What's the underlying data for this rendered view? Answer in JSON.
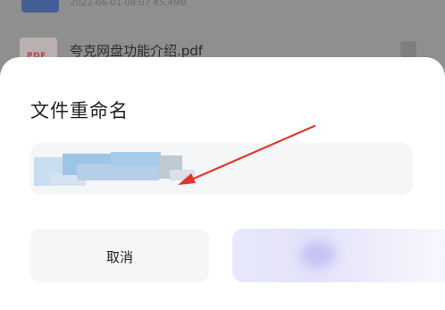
{
  "file_list": {
    "items": [
      {
        "meta": "2022-06-01 08:07  45.4MB"
      },
      {
        "name": "夸克网盘功能介绍.pdf",
        "type_label": "PDF"
      }
    ]
  },
  "rename_dialog": {
    "title": "文件重命名",
    "input_value": "",
    "cancel_label": "取消",
    "confirm_label": ""
  },
  "colors": {
    "annotation_arrow": "#e0392b",
    "dialog_bg": "#ffffff",
    "field_bg": "#f5f6f8",
    "confirm_tint": "#c6c2f6"
  },
  "icons": {
    "file_thumbnail": "video-file-thumbnail-icon",
    "pdf": "pdf-file-icon",
    "annotation": "red-arrow-annotation"
  }
}
